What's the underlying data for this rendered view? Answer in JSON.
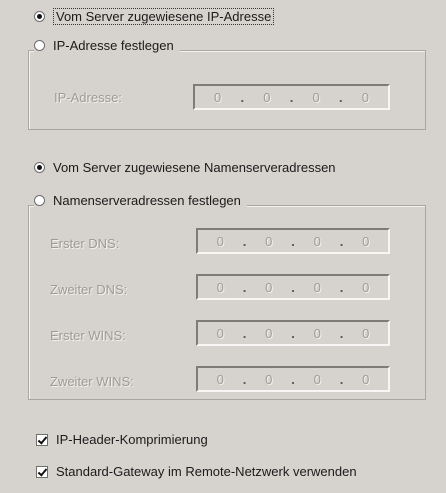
{
  "ip": {
    "auto_label": "Vom Server zugewiesene IP-Adresse",
    "manual_label": "IP-Adresse festlegen",
    "address_label": "IP-Adresse:",
    "address_octets": [
      "0",
      "0",
      "0",
      "0"
    ],
    "auto_selected": true
  },
  "dns": {
    "auto_label": "Vom Server zugewiesene Namenserveradressen",
    "manual_label": "Namenserveradressen festlegen",
    "auto_selected": true,
    "fields": [
      {
        "label": "Erster DNS:",
        "octets": [
          "0",
          "0",
          "0",
          "0"
        ]
      },
      {
        "label": "Zweiter DNS:",
        "octets": [
          "0",
          "0",
          "0",
          "0"
        ]
      },
      {
        "label": "Erster WINS:",
        "octets": [
          "0",
          "0",
          "0",
          "0"
        ]
      },
      {
        "label": "Zweiter WINS:",
        "octets": [
          "0",
          "0",
          "0",
          "0"
        ]
      }
    ]
  },
  "options": {
    "header_compression_label": "IP-Header-Komprimierung",
    "header_compression_checked": true,
    "default_gateway_label": "Standard-Gateway im Remote-Netzwerk verwenden",
    "default_gateway_checked": true
  }
}
